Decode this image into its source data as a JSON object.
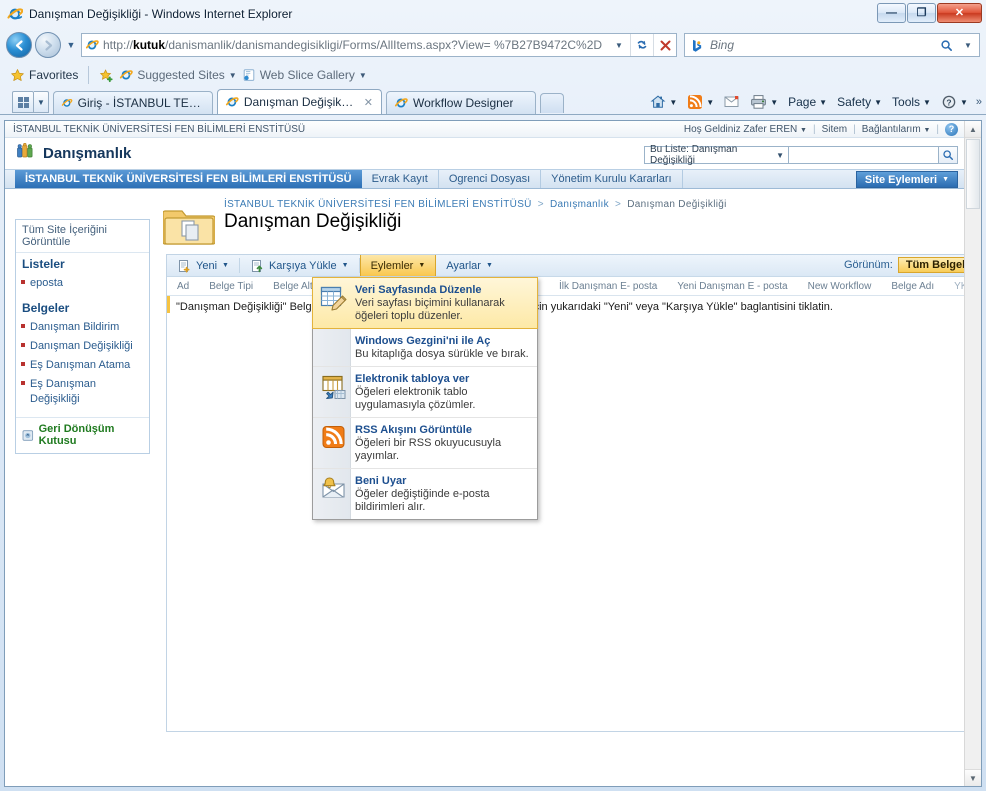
{
  "window": {
    "title": "Danışman Değişikliği - Windows Internet Explorer",
    "minimize_label": "—",
    "maximize_label": "❐",
    "close_label": "✕"
  },
  "browser": {
    "back_label": "◀",
    "forward_label": "▶",
    "history_caret": "▼",
    "address": {
      "protocol": "http://",
      "host": "kutuk",
      "path": "/danismanlik/danismandegisikligi/Forms/AllItems.aspx?View= %7B27B9472C%2D",
      "dropdown_label": "▼",
      "refresh_label": "↻",
      "stop_label": "✕"
    },
    "search": {
      "placeholder": "Bing",
      "caret": "▼"
    },
    "favorites_bar": {
      "favorites_label": "Favorites",
      "suggested_sites_label": "Suggested Sites",
      "web_slice_label": "Web Slice Gallery",
      "caret": "▼"
    },
    "tabs": [
      {
        "label": "Giriş - İSTANBUL TEKNİK ...",
        "active": false,
        "closable": false
      },
      {
        "label": "Danışman Değişikliği",
        "active": true,
        "closable": true,
        "close_label": "✕"
      },
      {
        "label": "Workflow Designer",
        "active": false,
        "closable": false
      }
    ],
    "command_bar": {
      "home_label": "",
      "feeds_label": "",
      "mail_label": "",
      "print_label": "",
      "page_label": "Page",
      "safety_label": "Safety",
      "tools_label": "Tools",
      "help_label": "",
      "overflow_label": "»",
      "caret": "▼"
    }
  },
  "sharepoint": {
    "global_nav": {
      "site_path": "İSTANBUL TEKNİK ÜNİVERSİTESİ FEN BİLİMLERİ ENSTİTÜSÜ",
      "welcome": "Hoş Geldiniz Zafer EREN",
      "sitem": "Sitem",
      "my_links": "Bağlantılarım",
      "caret": "▼",
      "sep": "|",
      "help_label": "?"
    },
    "site_title": "Danışmanlık",
    "top_nav": [
      {
        "label": "İSTANBUL TEKNİK ÜNİVERSİTESİ FEN BİLİMLERİ ENSTİTÜSÜ",
        "selected": true
      },
      {
        "label": "Evrak Kayıt",
        "selected": false
      },
      {
        "label": "Ogrenci Dosyası",
        "selected": false
      },
      {
        "label": "Yönetim Kurulu Kararları",
        "selected": false
      }
    ],
    "site_actions_label": "Site Eylemleri",
    "site_actions_caret": "▼",
    "search": {
      "scope_label": "Bu Liste: Danışman Değişikliği",
      "scope_caret": "▼",
      "input_value": "",
      "go_icon": "search-icon"
    },
    "quick_launch": {
      "view_all_label": "Tüm Site İçeriğini Görüntüle",
      "sections": [
        {
          "heading": "Listeler",
          "items": [
            {
              "label": "eposta"
            }
          ]
        },
        {
          "heading": "Belgeler",
          "items": [
            {
              "label": "Danışman Bildirim"
            },
            {
              "label": "Danışman Değişikliği"
            },
            {
              "label": "Eş Danışman Atama"
            },
            {
              "label": "Eş Danışman Değişikliği"
            }
          ]
        }
      ],
      "recycle_bin_label": "Geri Dönüşüm Kutusu"
    },
    "breadcrumb": [
      "İSTANBUL TEKNİK ÜNİVERSİTESİ FEN BİLİMLERİ ENSTİTÜSÜ",
      "Danışmanlık",
      "Danışman Değişikliği"
    ],
    "breadcrumb_sep": ">",
    "page_title": "Danışman Değişikliği",
    "toolbar": {
      "new_label": "Yeni",
      "upload_label": "Karşıya Yükle",
      "actions_label": "Eylemler",
      "settings_label": "Ayarlar",
      "caret": "▼",
      "view_prefix": "Görünüm:",
      "view_value": "Tüm Belgeler",
      "view_caret": "▼"
    },
    "list": {
      "columns": [
        {
          "label": "Ad",
          "dim": false
        },
        {
          "label": "Belge Tipi",
          "dim": false
        },
        {
          "label": "Belge Alt Tipi",
          "dim": false
        },
        {
          "label": "İlk Danışman E- posta",
          "dim": false
        },
        {
          "label": "Yeni Danışman E - posta",
          "dim": false
        },
        {
          "label": "New Workflow",
          "dim": false
        },
        {
          "label": "Belge Adı",
          "dim": false
        },
        {
          "label": "YK Kararı",
          "dim": true
        }
      ],
      "empty_message": "\"Danışman Değişikliği\" Belge kitaplığında hiç öğe yok. Yeni öğe eklemek için yukarıdaki \"Yeni\" veya \"Karşıya Yükle\" baglantisini tiklatin."
    },
    "actions_menu": [
      {
        "icon": "datasheet-edit-icon",
        "title": "Veri Sayfasında Düzenle",
        "description": "Veri sayfası biçimini kullanarak öğeleri toplu düzenler.",
        "highlighted": true
      },
      {
        "icon": "windows-explorer-icon",
        "title": "Windows Gezgini'ni ile Aç",
        "description": "Bu kitaplığa dosya sürükle ve bırak.",
        "highlighted": false
      },
      {
        "icon": "export-spreadsheet-icon",
        "title": "Elektronik tabloya ver",
        "description": "Öğeleri elektronik tablo uygulamasıyla çözümler.",
        "highlighted": false
      },
      {
        "icon": "rss-icon",
        "title": "RSS Akışını Görüntüle",
        "description": "Öğeleri bir RSS okuyucusuyla yayımlar.",
        "highlighted": false
      },
      {
        "icon": "alert-me-icon",
        "title": "Beni Uyar",
        "description": "Öğeler değiştiğinde e-posta bildirimleri alır.",
        "highlighted": false
      }
    ]
  },
  "colors": {
    "accent": "#2c6fb5",
    "highlight": "#f9c74f",
    "link": "#1d4f8f",
    "recycle": "#1f7a1f"
  }
}
